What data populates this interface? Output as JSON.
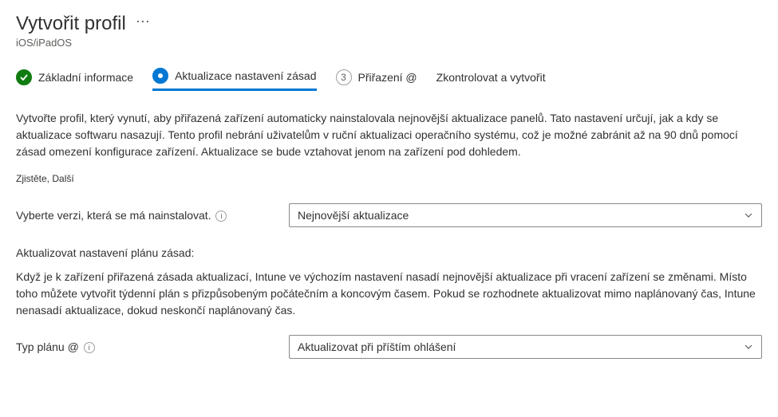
{
  "header": {
    "title": "Vytvořit profil",
    "subtitle": "iOS/iPadOS"
  },
  "stepper": {
    "step1_label": "Základní informace",
    "step2_label": "Aktualizace nastavení zásad",
    "step3_number": "3",
    "step3_label": "Přiřazení @",
    "step4_label": "Zkontrolovat a vytvořit"
  },
  "content": {
    "description": "Vytvořte profil, který vynutí, aby přiřazená zařízení automaticky nainstalovala nejnovější aktualizace panelů. Tato nastavení určují, jak a kdy se aktualizace softwaru nasazují. Tento profil nebrání uživatelům v ruční aktualizaci operačního systému, což je možné zabránit až na 90 dnů pomocí zásad omezení konfigurace zařízení. Aktualizace se bude vztahovat jenom na zařízení pod dohledem.",
    "learn_prefix": "Zjistěte,",
    "learn_link": "Další"
  },
  "form": {
    "version_label": "Vyberte verzi, která se má nainstalovat.",
    "version_value": "Nejnovější aktualizace",
    "schedule_heading": "Aktualizovat nastavení plánu zásad:",
    "schedule_description": "Když je k zařízení přiřazená zásada aktualizací, Intune ve výchozím nastavení nasadí nejnovější aktualizace při vracení zařízení se změnami. Místo toho můžete vytvořit týdenní plán s přizpůsobeným počátečním a koncovým časem. Pokud se rozhodnete aktualizovat mimo naplánovaný čas, Intune nenasadí aktualizace, dokud neskončí naplánovaný čas.",
    "plan_type_label": "Typ plánu @",
    "plan_type_value": "Aktualizovat při příštím ohlášení"
  }
}
